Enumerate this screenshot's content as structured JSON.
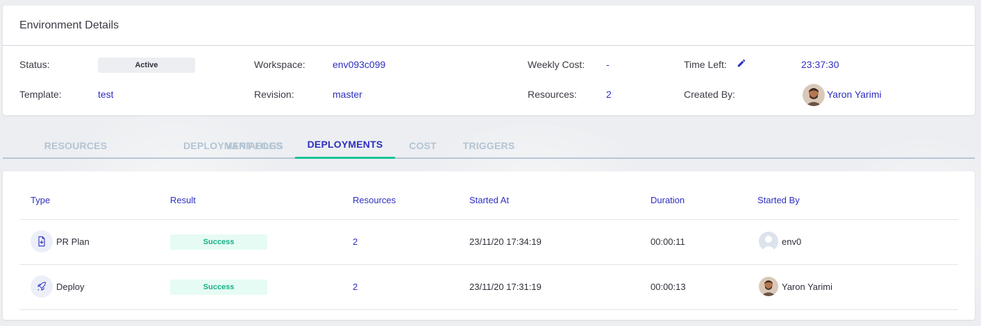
{
  "details": {
    "title": "Environment Details",
    "status_label": "Status:",
    "status_value": "Active",
    "template_label": "Template:",
    "template_value": "test",
    "workspace_label": "Workspace:",
    "workspace_value": "env093c099",
    "revision_label": "Revision:",
    "revision_value": "master",
    "weekly_cost_label": "Weekly Cost:",
    "weekly_cost_value": "-",
    "resources_label": "Resources:",
    "resources_value": "2",
    "time_left_label": "Time Left:",
    "time_left_value": "23:37:30",
    "created_by_label": "Created By:",
    "created_by_value": "Yaron Yarimi"
  },
  "tabs": [
    {
      "label": "RESOURCES"
    },
    {
      "label": "DEPLOYMENT-LOGS"
    },
    {
      "label": "VARIABLES"
    },
    {
      "label": "DEPLOYMENTS",
      "active": true
    },
    {
      "label": "COST"
    },
    {
      "label": "TRIGGERS"
    }
  ],
  "table": {
    "headers": [
      "Type",
      "Result",
      "Resources",
      "Started At",
      "Duration",
      "Started By"
    ],
    "rows": [
      {
        "type": "PR Plan",
        "type_icon": "document-plan-icon",
        "result": "Success",
        "resources": "2",
        "started_at": "23/11/20 17:34:19",
        "duration": "00:00:11",
        "started_by": "env0",
        "avatar": "default-user-avatar"
      },
      {
        "type": "Deploy",
        "type_icon": "rocket-icon",
        "result": "Success",
        "resources": "2",
        "started_at": "23/11/20 17:31:19",
        "duration": "00:00:13",
        "started_by": "Yaron Yarimi",
        "avatar": "user-photo-avatar"
      }
    ]
  },
  "colors": {
    "accent": "#2d2ec0",
    "success_text": "#18b087",
    "success_bg": "#e6fbf4",
    "tab_underline": "#19c39a",
    "tab_inactive": "#b2c4d4"
  }
}
